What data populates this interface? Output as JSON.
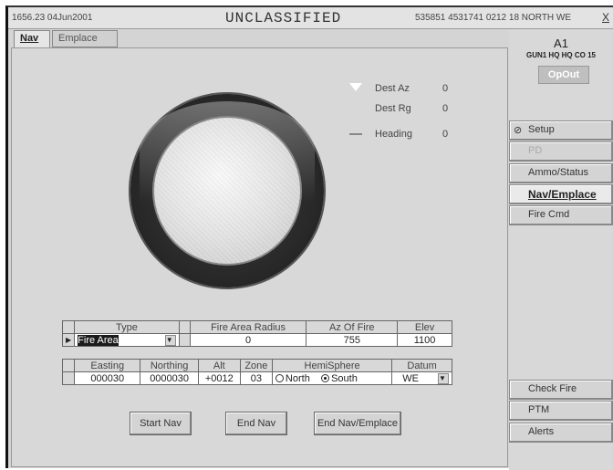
{
  "header": {
    "datetime": "1656.23 04Jun2001",
    "classification": "UNCLASSIFIED",
    "position": "535851 4531741 0212 18 NORTH WE",
    "close": "X"
  },
  "tabs": [
    {
      "label": "Nav"
    },
    {
      "label": "Emplace"
    }
  ],
  "readout": {
    "dest_az_label": "Dest Az",
    "dest_az_value": "0",
    "dest_rg_label": "Dest Rg",
    "dest_rg_value": "0",
    "heading_label": "Heading",
    "heading_value": "0"
  },
  "fire_area": {
    "headers": [
      "Type",
      "Fire Area Radius",
      "Az Of Fire",
      "Elev"
    ],
    "type": "Fire Area",
    "radius": "0",
    "az_of_fire": "755",
    "elev": "1100"
  },
  "location": {
    "headers": [
      "Easting",
      "Northing",
      "Alt",
      "Zone",
      "HemiSphere",
      "Datum"
    ],
    "easting": "000030",
    "northing": "0000030",
    "alt": "+0012",
    "zone": "03",
    "hemi_north": "North",
    "hemi_south": "South",
    "hemi_selected": "South",
    "datum": "WE"
  },
  "buttons": {
    "start_nav": "Start Nav",
    "end_nav": "End Nav",
    "end_nav_emplace": "End Nav/Emplace"
  },
  "side": {
    "unit_id": "A1",
    "unit_sub": "GUN1 HQ HQ CO 15",
    "status": "OpOut",
    "items": [
      {
        "label": "Setup",
        "icon": "no-entry-icon"
      },
      {
        "label": "PD"
      },
      {
        "label": "Ammo/Status"
      },
      {
        "label": "Nav/Emplace"
      },
      {
        "label": "Fire Cmd"
      }
    ],
    "bottom_items": [
      {
        "label": "Check Fire"
      },
      {
        "label": "PTM"
      },
      {
        "label": "Alerts"
      }
    ]
  }
}
